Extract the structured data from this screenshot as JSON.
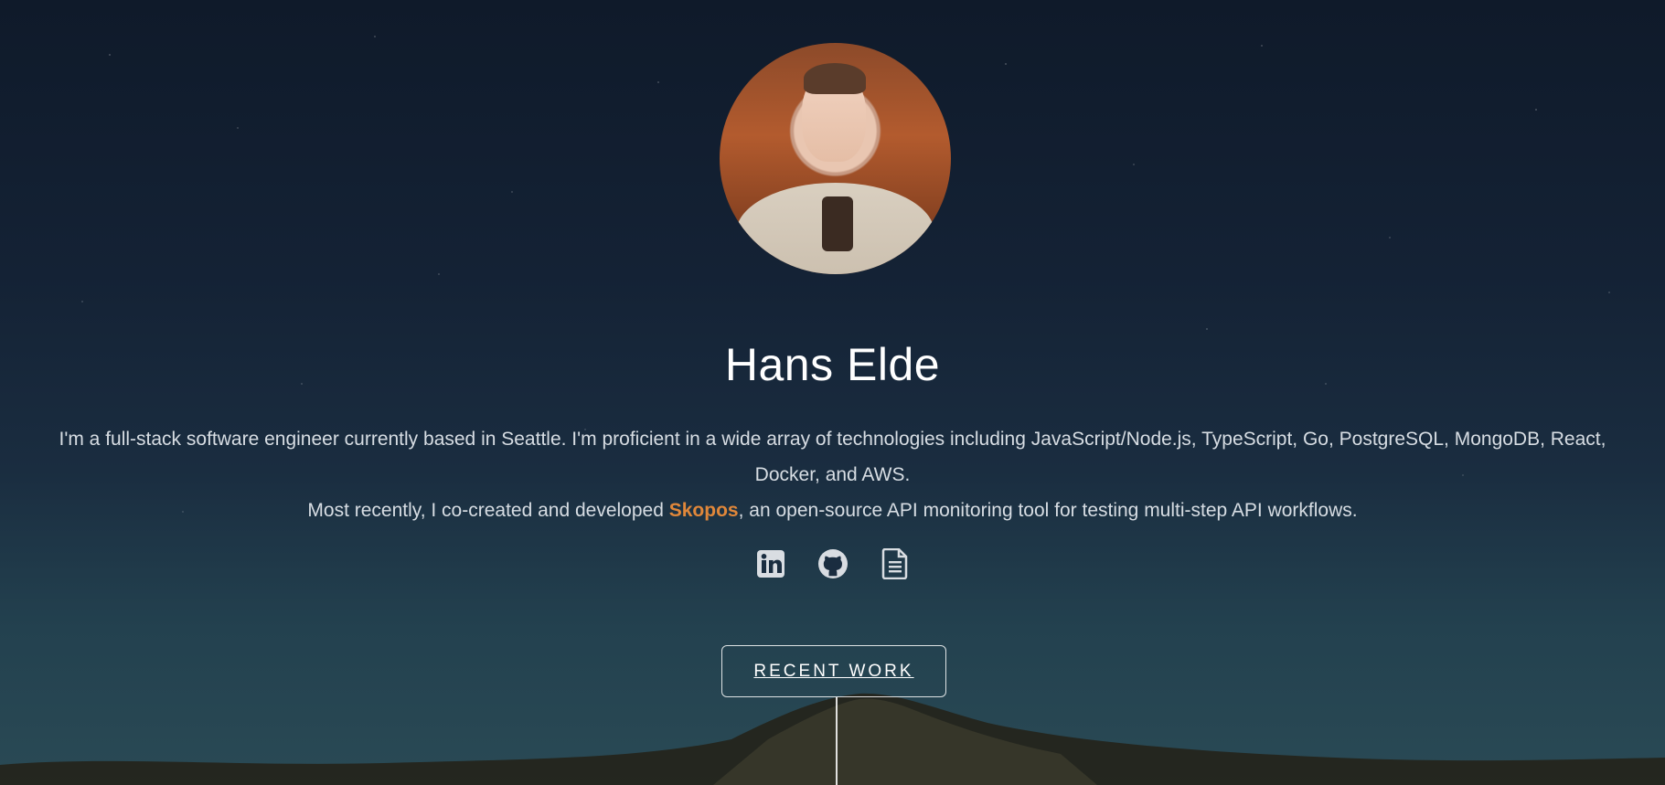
{
  "profile": {
    "name": "Hans Elde"
  },
  "bio": {
    "line1": "I'm a full-stack software engineer currently based in Seattle. I'm proficient in a wide array of technologies including JavaScript/Node.js, TypeScript, Go, PostgreSQL, MongoDB, React,",
    "line2": "Docker, and AWS.",
    "line3_prefix": "Most recently, I co-created and developed ",
    "project_link": "Skopos",
    "line3_suffix": ", an open-source API monitoring tool for testing multi-step API workflows."
  },
  "social_icons": [
    {
      "name": "linkedin-icon"
    },
    {
      "name": "github-icon"
    },
    {
      "name": "resume-document-icon"
    }
  ],
  "cta": {
    "label": "RECENT WORK"
  },
  "colors": {
    "accent": "#e0873a"
  }
}
